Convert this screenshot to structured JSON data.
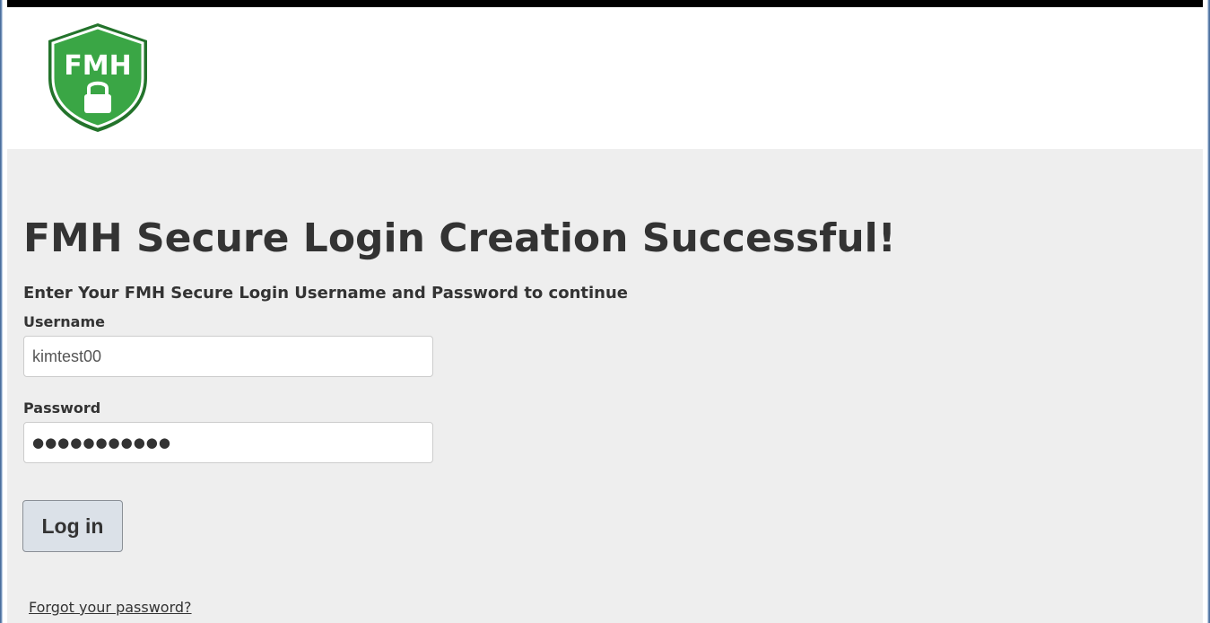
{
  "header": {
    "logo_text": "FMH"
  },
  "main": {
    "title": "FMH Secure Login Creation Successful!",
    "subtitle": "Enter Your FMH Secure Login Username and Password to continue",
    "username": {
      "label": "Username",
      "value": "kimtest00"
    },
    "password": {
      "label": "Password",
      "masked_value": "●●●●●●●●●●●"
    },
    "login_button": "Log in",
    "forgot_link": "Forgot your password?"
  },
  "colors": {
    "logo_green": "#3aa645",
    "logo_dark_green": "#23732b",
    "background": "#eeeeee",
    "text": "#333333"
  },
  "icons": {
    "logo": "shield-lock-icon"
  }
}
